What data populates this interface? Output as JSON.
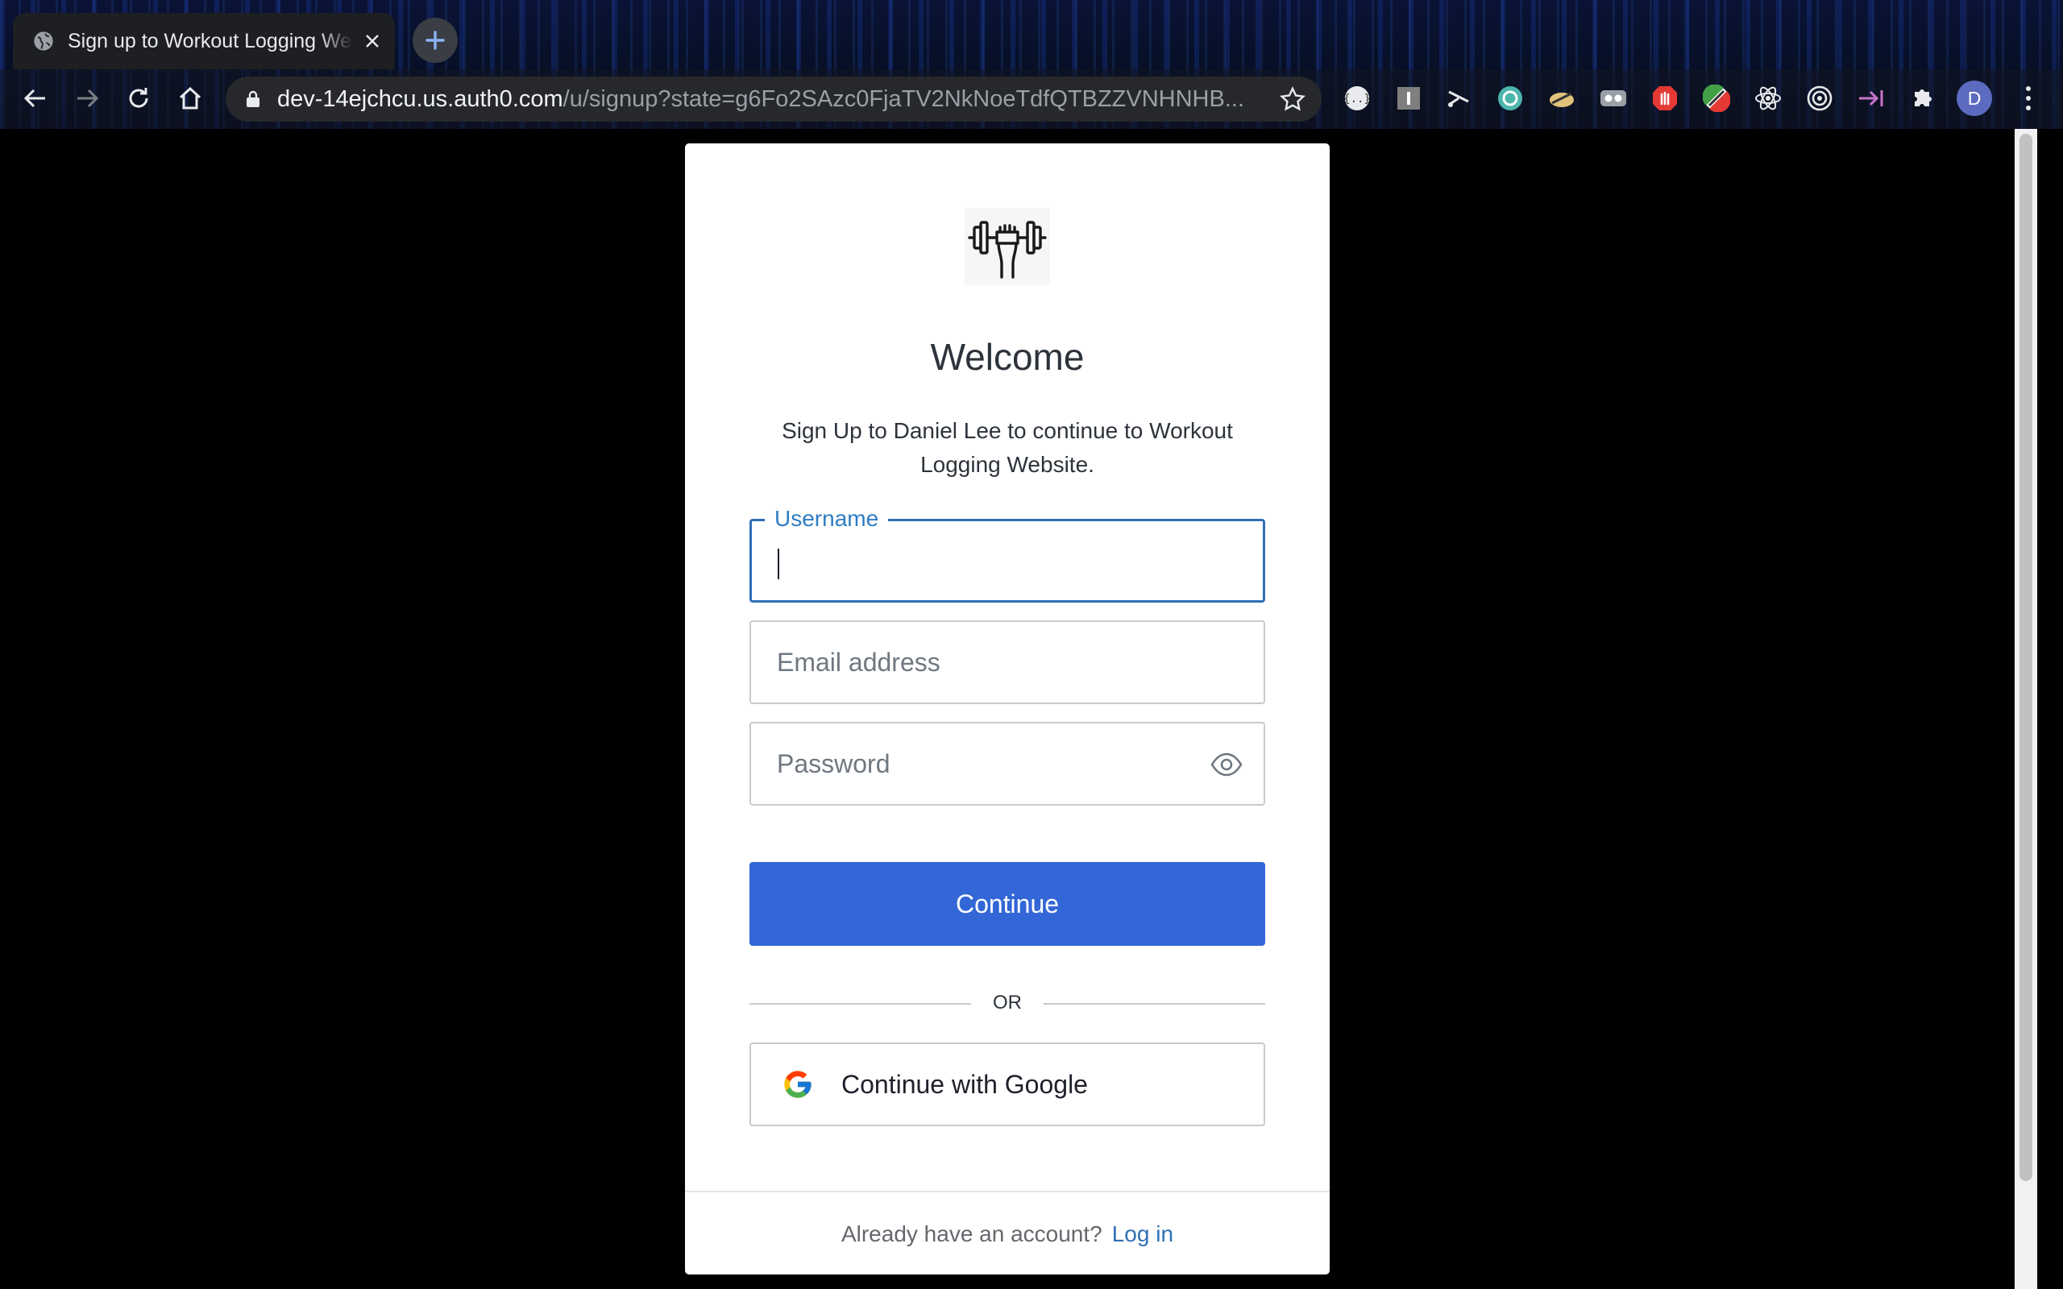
{
  "browser": {
    "tab_title": "Sign up to Workout Logging Website",
    "url_host": "dev-14ejchcu.us.auth0.com",
    "url_path": "/u/signup?state=g6Fo2SAzc0FjaTV2NkNoeTdfQTBZZVNHNHB...",
    "profile_initial": "D",
    "extensions": [
      "json-viewer-icon",
      "extension-i-icon",
      "scissors-icon",
      "sync-icon",
      "cloud-icon",
      "glasses-icon",
      "adblock-hand-icon",
      "color-picker-icon",
      "react-devtools-icon",
      "target-icon",
      "arrow-to-line-icon",
      "puzzle-icon"
    ]
  },
  "signup": {
    "title": "Welcome",
    "subtitle": "Sign Up to Daniel Lee to continue to Workout Logging Website.",
    "username_label": "Username",
    "username_value": "",
    "email_placeholder": "Email address",
    "password_placeholder": "Password",
    "continue_label": "Continue",
    "divider_text": "OR",
    "google_label": "Continue with Google",
    "footer_question": "Already have an account?",
    "footer_link": "Log in"
  },
  "colors": {
    "primary_button": "#3366d6",
    "focus_border": "#2f6fb6",
    "link": "#2f6fb6"
  }
}
